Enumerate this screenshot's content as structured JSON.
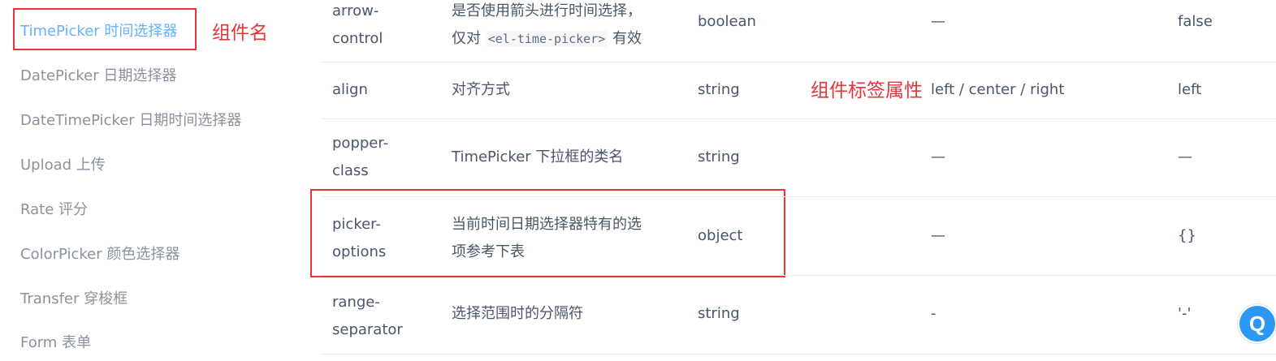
{
  "sidebar": {
    "items": [
      {
        "label": "TimePicker 时间选择器",
        "active": true
      },
      {
        "label": "DatePicker 日期选择器"
      },
      {
        "label": "DateTimePicker 日期时间选择器"
      },
      {
        "label": "Upload 上传"
      },
      {
        "label": "Rate 评分"
      },
      {
        "label": "ColorPicker 颜色选择器"
      },
      {
        "label": "Transfer 穿梭框"
      },
      {
        "label": "Form 表单"
      }
    ]
  },
  "annotations": {
    "component_name": "组件名",
    "tag_attributes": "组件标签属性",
    "annotation_color": "#e8333a"
  },
  "table": {
    "rows": [
      {
        "param_line1": "arrow-",
        "param_line2": "control",
        "desc_line1": "是否使用箭头进行时间选择，",
        "desc_pre": "仅对 ",
        "desc_code": "<el-time-picker>",
        "desc_post": " 有效",
        "type": "boolean",
        "options": "—",
        "default": "false"
      },
      {
        "param": "align",
        "desc": "对齐方式",
        "type": "string",
        "options": "left / center / right",
        "default": "left"
      },
      {
        "param_line1": "popper-",
        "param_line2": "class",
        "desc": "TimePicker 下拉框的类名",
        "type": "string",
        "options": "—",
        "default": "—"
      },
      {
        "param_line1": "picker-",
        "param_line2": "options",
        "desc_line1": "当前时间日期选择器特有的选",
        "desc_line2": "项参考下表",
        "type": "object",
        "options": "—",
        "default": "{}"
      },
      {
        "param_line1": "range-",
        "param_line2": "separator",
        "desc": "选择范围时的分隔符",
        "type": "string",
        "options": "-",
        "default": "'-'"
      }
    ]
  },
  "float_button": {
    "icon": "q-icon",
    "glyph": "Q"
  },
  "colors": {
    "sidebar_active": "#63b3ff",
    "sidebar_text": "#8a929d",
    "table_text": "#48576a",
    "divider": "#e3e8ee",
    "float_button": "#2b98f5"
  }
}
